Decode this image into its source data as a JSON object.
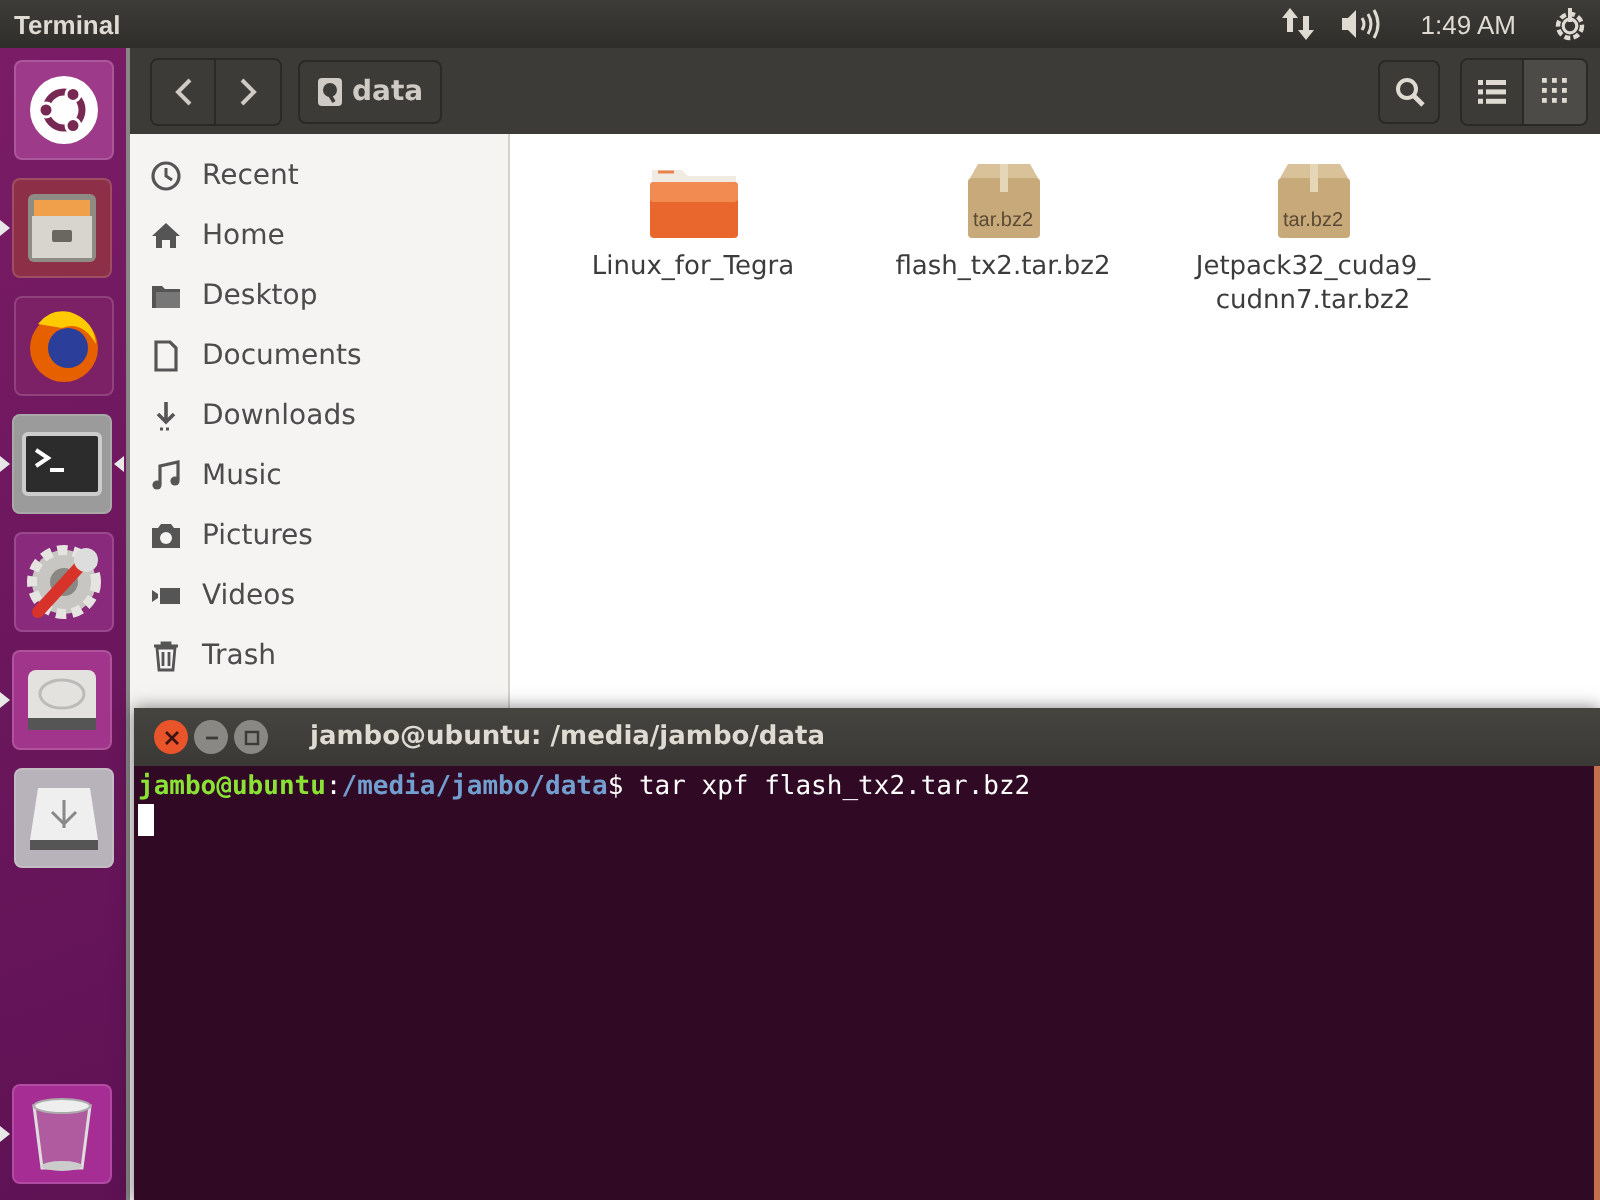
{
  "top_panel": {
    "title": "Terminal",
    "clock": "1:49 AM"
  },
  "launcher": {
    "items": [
      {
        "kind": "dash",
        "running": false,
        "focused": false
      },
      {
        "kind": "files",
        "running": true,
        "focused": false
      },
      {
        "kind": "firefox",
        "running": false,
        "focused": false
      },
      {
        "kind": "terminal",
        "running": true,
        "focused": true
      },
      {
        "kind": "settings",
        "running": false,
        "focused": false
      },
      {
        "kind": "disk",
        "running": true,
        "focused": false
      },
      {
        "kind": "usb",
        "running": false,
        "focused": false
      }
    ],
    "trash": {
      "running": true,
      "focused": false
    }
  },
  "file_manager": {
    "path_button": "data",
    "view_buttons": [
      {
        "kind": "list",
        "selected": false
      },
      {
        "kind": "grid",
        "selected": true
      }
    ],
    "sidebar": {
      "items": [
        {
          "kind": "recent",
          "label": "Recent"
        },
        {
          "kind": "home",
          "label": "Home"
        },
        {
          "kind": "folder",
          "label": "Desktop"
        },
        {
          "kind": "document",
          "label": "Documents"
        },
        {
          "kind": "download",
          "label": "Downloads"
        },
        {
          "kind": "music",
          "label": "Music"
        },
        {
          "kind": "camera",
          "label": "Pictures"
        },
        {
          "kind": "video",
          "label": "Videos"
        },
        {
          "kind": "trash",
          "label": "Trash"
        }
      ]
    },
    "files": [
      {
        "kind": "folder",
        "name": "Linux_for_Tegra"
      },
      {
        "kind": "archive",
        "name": "flash_tx2.tar.bz2",
        "badge": "tar.bz2"
      },
      {
        "kind": "archive",
        "name": "Jetpack32_cuda9_\ncudnn7.tar.bz2",
        "badge": "tar.bz2"
      }
    ]
  },
  "terminal": {
    "title": "jambo@ubuntu: /media/jambo/data",
    "lines": [
      {
        "user": "jambo@ubuntu",
        "separator": ":",
        "path": "/media/jambo/data",
        "command": "$ tar xpf flash_tx2.tar.bz2"
      }
    ],
    "cursor": true
  }
}
